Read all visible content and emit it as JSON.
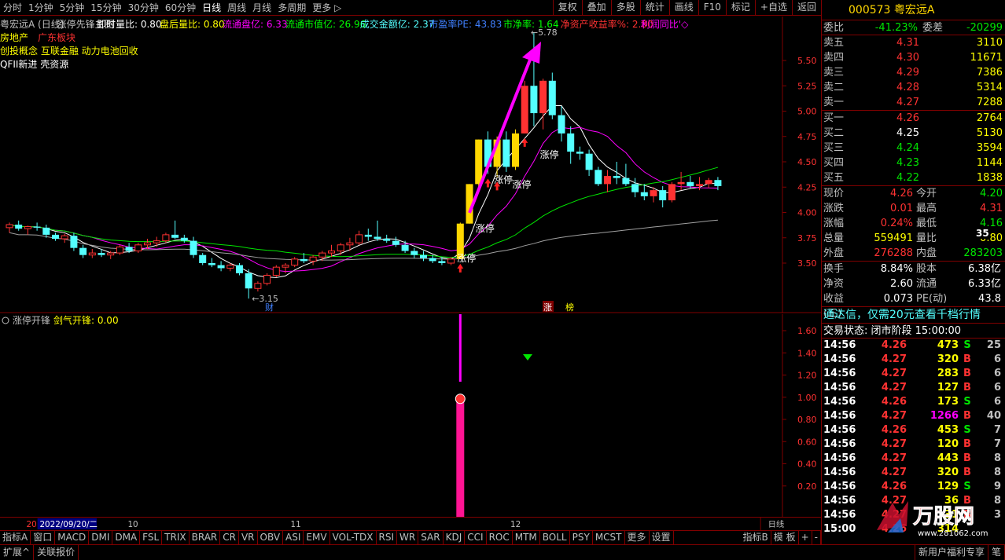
{
  "toolbar": {
    "periods": [
      "分时",
      "1分钟",
      "5分钟",
      "15分钟",
      "30分钟",
      "60分钟",
      "日线",
      "周线",
      "月线",
      "多周期",
      "更多 ▷"
    ],
    "active_period": "日线",
    "tools": [
      "复权",
      "叠加",
      "多股",
      "统计",
      "画线",
      "F10",
      "标记",
      "+自选",
      "返回"
    ]
  },
  "main": {
    "header_items": [
      {
        "text": "粤宏远A (日线)",
        "color": "#c0c0c0"
      },
      {
        "text": "涨停先锋主图",
        "color": "#c0c0c0"
      },
      {
        "text": "即时量比: 0.80",
        "color": "#ffffff"
      },
      {
        "text": "盘后量比: 0.80",
        "color": "#ffff00"
      },
      {
        "text": "流通盘亿: 6.33",
        "color": "#ff00ff"
      },
      {
        "text": "流通市值亿: 26.96",
        "color": "#00ff00"
      },
      {
        "text": "成交金额亿: 2.37",
        "color": "#54ffff"
      },
      {
        "text": "市盈率PE: 43.83",
        "color": "#4080ff"
      },
      {
        "text": "市净率: 1.64",
        "color": "#00ff00"
      },
      {
        "text": "净资产收益率%: 2.80",
        "color": "#ff3232"
      },
      {
        "text": "利润同比'◇",
        "color": "#ff00ff"
      }
    ],
    "concept_lines": [
      [
        {
          "text": "房地产",
          "color": "#ffff00"
        },
        {
          "text": "广东板块",
          "color": "#ff3232"
        }
      ],
      [
        {
          "text": "创投概念 互联金融 动力电池回收",
          "color": "#ffff00"
        }
      ],
      [
        {
          "text": "QFII新进 壳资源",
          "color": "#ffffff"
        }
      ]
    ],
    "price_ticks": [
      "5.50",
      "5.25",
      "5.00",
      "4.75",
      "4.50",
      "4.25",
      "4.00",
      "3.75",
      "3.50"
    ],
    "high_label": "5.78",
    "low_label": "3.15",
    "limit_up_label": "涨停",
    "event_labels": [
      "财",
      "涨",
      "榜"
    ]
  },
  "sub": {
    "header": "涨停开锋",
    "value_label": "剑气开锋: 0.00",
    "ticks": [
      "1.60",
      "1.40",
      "1.20",
      "1.00",
      "0.80",
      "0.60",
      "0.40",
      "0.20"
    ]
  },
  "timeaxis": {
    "date": "2022/09/20/二",
    "months": [
      "10",
      "11",
      "12"
    ],
    "start_label": "20",
    "period_label": "日线"
  },
  "bottom_tabs": [
    "指标A",
    "窗口",
    "MACD",
    "DMI",
    "DMA",
    "FSL",
    "TRIX",
    "BRAR",
    "CR",
    "VR",
    "OBV",
    "ASI",
    "EMV",
    "VOL-TDX",
    "RSI",
    "WR",
    "SAR",
    "KDJ",
    "CCI",
    "ROC",
    "MTM",
    "BOLL",
    "PSY",
    "MCST",
    "更多",
    "设置"
  ],
  "bottom_right_tabs": [
    "指标B",
    "模 板",
    "+",
    "-"
  ],
  "status": [
    "扩展^",
    "关联报价"
  ],
  "status_right": [
    "新用户福利专享",
    "笔"
  ],
  "side": {
    "code_name": "000573 粤宏远A",
    "weibi": {
      "label": "委比",
      "value": "-41.23%",
      "label2": "委差",
      "value2": "-20299"
    },
    "asks": [
      {
        "label": "卖五",
        "price": "4.31",
        "vol": "3110"
      },
      {
        "label": "卖四",
        "price": "4.30",
        "vol": "11671"
      },
      {
        "label": "卖三",
        "price": "4.29",
        "vol": "7386"
      },
      {
        "label": "卖二",
        "price": "4.28",
        "vol": "5314"
      },
      {
        "label": "卖一",
        "price": "4.27",
        "vol": "7288"
      }
    ],
    "bids": [
      {
        "label": "买一",
        "price": "4.26",
        "vol": "2764",
        "pc": "#ff3232"
      },
      {
        "label": "买二",
        "price": "4.25",
        "vol": "5130",
        "pc": "#ffffff"
      },
      {
        "label": "买三",
        "price": "4.24",
        "vol": "3594",
        "pc": "#00e600"
      },
      {
        "label": "买四",
        "price": "4.23",
        "vol": "1144",
        "pc": "#00e600"
      },
      {
        "label": "买五",
        "price": "4.22",
        "vol": "1838",
        "pc": "#00e600"
      }
    ],
    "quote": [
      {
        "l1": "现价",
        "v1": "4.26",
        "c1": "#ff3232",
        "l2": "今开",
        "v2": "4.20",
        "c2": "#00e600"
      },
      {
        "l1": "涨跌",
        "v1": "0.01",
        "c1": "#ff3232",
        "l2": "最高",
        "v2": "4.31",
        "c2": "#ff3232"
      },
      {
        "l1": "涨幅",
        "v1": "0.24%",
        "c1": "#ff3232",
        "l2": "最低",
        "v2": "4.16",
        "c2": "#00e600"
      },
      {
        "l1": "总量",
        "v1": "559491",
        "c1": "#ffff00",
        "l2": "量比",
        "v2": "0.80",
        "c2": "#ffff00"
      },
      {
        "l1": "外盘",
        "v1": "276288",
        "c1": "#ff3232",
        "l2": "内盘",
        "v2": "283203",
        "c2": "#00e600"
      }
    ],
    "fundamentals": [
      {
        "l1": "换手",
        "v1": "8.84%",
        "l2": "股本",
        "v2": "6.38亿"
      },
      {
        "l1": "净资",
        "v1": "2.60",
        "l2": "流通",
        "v2": "6.33亿"
      },
      {
        "l1": "收益(三)",
        "v1": "0.073",
        "l2": "PE(动)",
        "v2": "43.8"
      }
    ],
    "ad": "通达信，仅需20元查看千档行情",
    "trade_state": "交易状态: 闭市阶段 15:00:00",
    "ticks": [
      {
        "t": "14:56",
        "p": "4.26",
        "v": "473",
        "bs": "S",
        "n": "25"
      },
      {
        "t": "14:56",
        "p": "4.27",
        "v": "320",
        "bs": "B",
        "n": "6"
      },
      {
        "t": "14:56",
        "p": "4.27",
        "v": "283",
        "bs": "B",
        "n": "6"
      },
      {
        "t": "14:56",
        "p": "4.27",
        "v": "127",
        "bs": "B",
        "n": "6"
      },
      {
        "t": "14:56",
        "p": "4.26",
        "v": "173",
        "bs": "S",
        "n": "6"
      },
      {
        "t": "14:56",
        "p": "4.27",
        "v": "1266",
        "bs": "B",
        "n": "40"
      },
      {
        "t": "14:56",
        "p": "4.26",
        "v": "453",
        "bs": "S",
        "n": "7"
      },
      {
        "t": "14:56",
        "p": "4.27",
        "v": "120",
        "bs": "B",
        "n": "7"
      },
      {
        "t": "14:56",
        "p": "4.27",
        "v": "443",
        "bs": "B",
        "n": "8"
      },
      {
        "t": "14:56",
        "p": "4.27",
        "v": "320",
        "bs": "B",
        "n": "8"
      },
      {
        "t": "14:56",
        "p": "4.26",
        "v": "129",
        "bs": "S",
        "n": "9"
      },
      {
        "t": "14:56",
        "p": "4.27",
        "v": "36",
        "bs": "B",
        "n": "8"
      },
      {
        "t": "14:56",
        "p": "4.27",
        "v": "31",
        "bs": "B",
        "n": "3"
      },
      {
        "t": "15:00",
        "p": "4.26",
        "v": "314",
        "bs": "",
        "n": ""
      }
    ],
    "badge": "35",
    "watermark": "万股网",
    "watermark_url": "www.281062.com"
  },
  "colors": {
    "up": "#ff3232",
    "down": "#54ffff",
    "limit_up": "#ffd700",
    "ma5": "#ffffff",
    "ma10": "#ff00ff",
    "ma20": "#00e600",
    "ma60": "#a0a0a0",
    "arrow": "#ff00ff"
  },
  "chart_data": {
    "type": "candlestick",
    "candles": [
      [
        3.85,
        3.9,
        3.8,
        3.88
      ],
      [
        3.88,
        3.92,
        3.82,
        3.84
      ],
      [
        3.84,
        3.87,
        3.78,
        3.86
      ],
      [
        3.86,
        3.9,
        3.82,
        3.85
      ],
      [
        3.85,
        3.88,
        3.75,
        3.78
      ],
      [
        3.78,
        3.8,
        3.72,
        3.74
      ],
      [
        3.74,
        3.79,
        3.7,
        3.77
      ],
      [
        3.77,
        3.8,
        3.62,
        3.65
      ],
      [
        3.65,
        3.68,
        3.55,
        3.58
      ],
      [
        3.58,
        3.64,
        3.55,
        3.6
      ],
      [
        3.6,
        3.64,
        3.56,
        3.58
      ],
      [
        3.58,
        3.62,
        3.54,
        3.6
      ],
      [
        3.6,
        3.68,
        3.58,
        3.66
      ],
      [
        3.66,
        3.7,
        3.6,
        3.62
      ],
      [
        3.62,
        3.7,
        3.6,
        3.68
      ],
      [
        3.68,
        3.74,
        3.64,
        3.7
      ],
      [
        3.7,
        3.76,
        3.66,
        3.72
      ],
      [
        3.72,
        3.8,
        3.7,
        3.78
      ],
      [
        3.78,
        3.92,
        3.74,
        3.75
      ],
      [
        3.75,
        3.78,
        3.7,
        3.72
      ],
      [
        3.72,
        3.76,
        3.55,
        3.58
      ],
      [
        3.58,
        3.6,
        3.48,
        3.5
      ],
      [
        3.5,
        3.55,
        3.46,
        3.48
      ],
      [
        3.48,
        3.52,
        3.42,
        3.45
      ],
      [
        3.45,
        3.5,
        3.42,
        3.48
      ],
      [
        3.48,
        3.5,
        3.38,
        3.4
      ],
      [
        3.4,
        3.44,
        3.15,
        3.25
      ],
      [
        3.25,
        3.32,
        3.22,
        3.3
      ],
      [
        3.3,
        3.4,
        3.28,
        3.38
      ],
      [
        3.38,
        3.48,
        3.36,
        3.46
      ],
      [
        3.46,
        3.5,
        3.4,
        3.48
      ],
      [
        3.48,
        3.56,
        3.46,
        3.54
      ],
      [
        3.54,
        3.6,
        3.5,
        3.52
      ],
      [
        3.52,
        3.58,
        3.48,
        3.56
      ],
      [
        3.56,
        3.62,
        3.52,
        3.6
      ],
      [
        3.6,
        3.68,
        3.56,
        3.62
      ],
      [
        3.62,
        3.7,
        3.58,
        3.68
      ],
      [
        3.68,
        3.75,
        3.62,
        3.7
      ],
      [
        3.7,
        3.82,
        3.68,
        3.78
      ],
      [
        3.78,
        3.84,
        3.72,
        3.76
      ],
      [
        3.76,
        3.92,
        3.72,
        3.74
      ],
      [
        3.74,
        3.78,
        3.7,
        3.72
      ],
      [
        3.72,
        3.76,
        3.66,
        3.68
      ],
      [
        3.68,
        3.72,
        3.6,
        3.62
      ],
      [
        3.62,
        3.65,
        3.55,
        3.58
      ],
      [
        3.58,
        3.62,
        3.52,
        3.55
      ],
      [
        3.55,
        3.58,
        3.5,
        3.52
      ],
      [
        3.52,
        3.56,
        3.48,
        3.5
      ],
      [
        3.5,
        3.56,
        3.48,
        3.54
      ],
      [
        3.54,
        3.9,
        3.54,
        3.89
      ],
      [
        3.89,
        4.28,
        3.89,
        4.28
      ],
      [
        4.28,
        4.72,
        4.24,
        4.72
      ],
      [
        4.72,
        4.8,
        4.38,
        4.45
      ],
      [
        4.45,
        4.75,
        4.35,
        4.72
      ],
      [
        4.72,
        4.8,
        4.4,
        4.45
      ],
      [
        4.45,
        4.82,
        4.42,
        4.78
      ],
      [
        4.78,
        5.3,
        4.78,
        5.25
      ],
      [
        5.25,
        5.78,
        4.85,
        4.98
      ],
      [
        4.98,
        5.32,
        4.82,
        5.3
      ],
      [
        5.3,
        5.38,
        4.92,
        4.96
      ],
      [
        4.96,
        5.05,
        4.7,
        4.78
      ],
      [
        4.78,
        4.85,
        4.48,
        4.6
      ],
      [
        4.6,
        4.65,
        4.52,
        4.58
      ],
      [
        4.58,
        4.62,
        4.36,
        4.42
      ],
      [
        4.42,
        4.45,
        4.26,
        4.28
      ],
      [
        4.28,
        4.42,
        4.2,
        4.36
      ],
      [
        4.36,
        4.5,
        4.28,
        4.34
      ],
      [
        4.34,
        4.48,
        4.26,
        4.28
      ],
      [
        4.28,
        4.34,
        4.15,
        4.2
      ],
      [
        4.2,
        4.28,
        4.12,
        4.16
      ],
      [
        4.16,
        4.25,
        4.1,
        4.22
      ],
      [
        4.22,
        4.26,
        4.05,
        4.12
      ],
      [
        4.12,
        4.3,
        4.1,
        4.28
      ],
      [
        4.28,
        4.4,
        4.22,
        4.3
      ],
      [
        4.3,
        4.36,
        4.24,
        4.26
      ],
      [
        4.26,
        4.35,
        4.22,
        4.28
      ],
      [
        4.28,
        4.34,
        4.24,
        4.32
      ],
      [
        4.32,
        4.35,
        4.22,
        4.26
      ]
    ],
    "ylim": [
      3.0,
      6.0
    ],
    "limit_up_days": [
      49,
      50,
      51,
      53,
      55
    ],
    "signal_value": 1.0,
    "signal_index": 49,
    "sub_ylim": [
      0,
      1.7
    ]
  }
}
